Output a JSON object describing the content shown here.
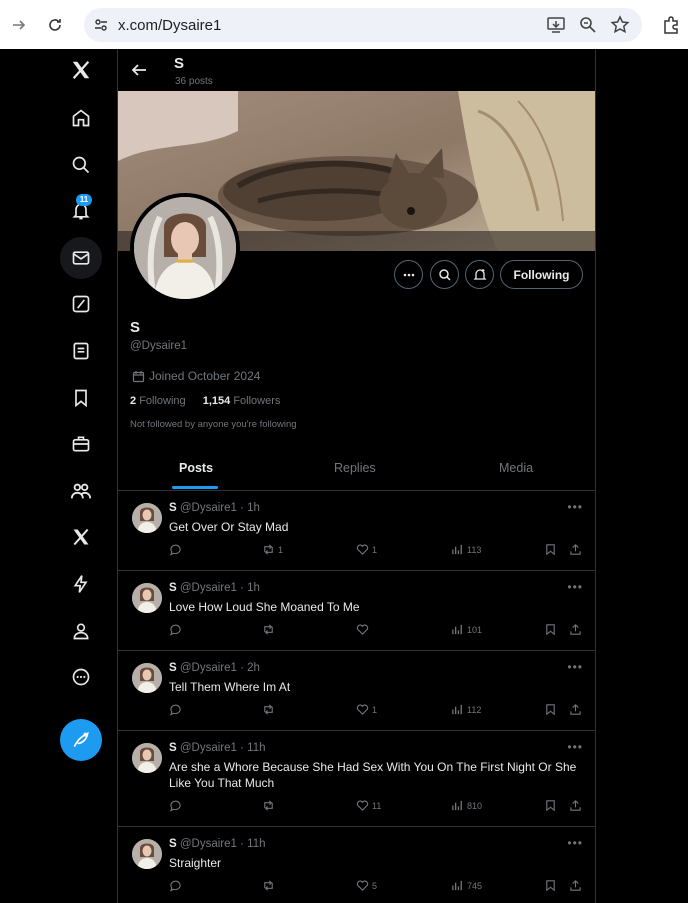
{
  "browser": {
    "url": "x.com/Dysaire1",
    "buttons": [
      "forward-icon",
      "reload-icon",
      "install-app-icon",
      "zoom-icon",
      "star-icon",
      "extensions-icon"
    ]
  },
  "nav": {
    "notification_badge": "11",
    "items": [
      "x-logo-icon",
      "home-icon",
      "search-icon",
      "notifications-icon",
      "messages-icon",
      "grok-icon",
      "lists-icon",
      "bookmarks-icon",
      "jobs-icon",
      "communities-icon",
      "premium-icon",
      "verified-orgs-icon",
      "profile-icon",
      "more-icon"
    ]
  },
  "header": {
    "name": "S",
    "posts_count": "36 posts"
  },
  "profile": {
    "name": "S",
    "handle": "@Dysaire1",
    "joined": "Joined October 2024",
    "following_count": "2",
    "following_label": "Following",
    "followers_count": "1,154",
    "followers_label": "Followers",
    "not_followed": "Not followed by anyone you're following",
    "follow_button": "Following"
  },
  "tabs": [
    {
      "label": "Posts",
      "active": true
    },
    {
      "label": "Replies",
      "active": false
    },
    {
      "label": "Media",
      "active": false
    }
  ],
  "tweets": [
    {
      "name": "S",
      "meta": "@Dysaire1 · 1h",
      "text": "Get Over Or Stay Mad",
      "reposts": "1",
      "likes": "1",
      "views": "113"
    },
    {
      "name": "S",
      "meta": "@Dysaire1 · 1h",
      "text": "Love How Loud She Moaned To Me",
      "reposts": "",
      "likes": "",
      "views": "101"
    },
    {
      "name": "S",
      "meta": "@Dysaire1 · 2h",
      "text": "Tell Them Where Im At",
      "reposts": "",
      "likes": "1",
      "views": "112"
    },
    {
      "name": "S",
      "meta": "@Dysaire1 · 11h",
      "text": "Are she a Whore Because She Had Sex With You On The First Night Or She Like You That Much",
      "reposts": "",
      "likes": "11",
      "views": "810"
    },
    {
      "name": "S",
      "meta": "@Dysaire1 · 11h",
      "text": "Straighter",
      "reposts": "",
      "likes": "5",
      "views": "745"
    }
  ]
}
